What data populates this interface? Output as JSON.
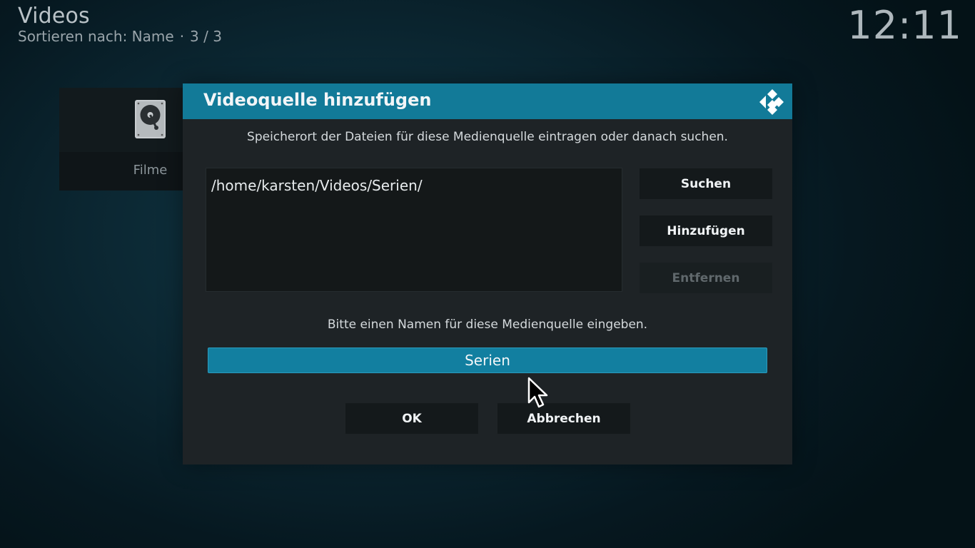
{
  "header": {
    "title": "Videos",
    "sort_label": "Sortieren nach: Name",
    "separator": "·",
    "page_count": "3 / 3",
    "clock": "12:11"
  },
  "background_tile": {
    "label": "Filme",
    "icon": "hard-drive-icon"
  },
  "dialog": {
    "title": "Videoquelle hinzufügen",
    "close_icon": "kodi-logo-icon",
    "path_instruction": "Speicherort der Dateien für diese Medienquelle eintragen oder danach suchen.",
    "paths": [
      "/home/karsten/Videos/Serien/"
    ],
    "buttons": {
      "browse": "Suchen",
      "add": "Hinzufügen",
      "remove": "Entfernen"
    },
    "name_instruction": "Bitte einen Namen für diese Medienquelle eingeben.",
    "name_value": "Serien",
    "ok": "OK",
    "cancel": "Abbrechen"
  },
  "colors": {
    "accent": "#127a98",
    "dialog_bg": "#1e2326",
    "button_bg": "#14191b",
    "disabled_text": "#60686c"
  }
}
